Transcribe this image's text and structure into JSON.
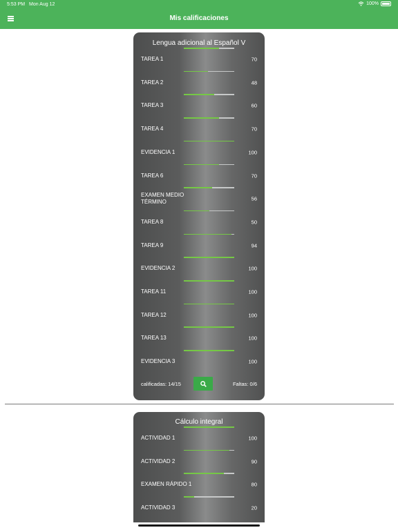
{
  "status": {
    "time": "5:53 PM",
    "date": "Mon Aug 12",
    "battery": "100%"
  },
  "header": {
    "title": "Mis calificaciones"
  },
  "courses": [
    {
      "title": "Lengua adicional al Español V",
      "items": [
        {
          "label": "TAREA 1",
          "score": "70",
          "value": 0.7
        },
        {
          "label": "TAREA 2",
          "score": "48",
          "value": 0.48
        },
        {
          "label": "TAREA 3",
          "score": "60",
          "value": 0.6
        },
        {
          "label": "TAREA 4",
          "score": "70",
          "value": 0.7
        },
        {
          "label": "EVIDENCIA 1",
          "score": "100",
          "value": 1.0
        },
        {
          "label": "TAREA 6",
          "score": "70",
          "value": 0.7
        },
        {
          "label": "EXAMEN MEDIO TÉRMINO",
          "score": "56",
          "value": 0.56
        },
        {
          "label": "TAREA 8",
          "score": "50",
          "value": 0.5
        },
        {
          "label": "TAREA 9",
          "score": "94",
          "value": 0.94
        },
        {
          "label": "EVIDENCIA 2",
          "score": "100",
          "value": 1.0
        },
        {
          "label": "TAREA 11",
          "score": "100",
          "value": 1.0
        },
        {
          "label": "TAREA 12",
          "score": "100",
          "value": 1.0
        },
        {
          "label": "TAREA 13",
          "score": "100",
          "value": 1.0
        },
        {
          "label": "EVIDENCIA 3",
          "score": "100",
          "value": 1.0
        }
      ],
      "graded": "calificadas: 14/15",
      "absences": "Faltas: 0/6"
    },
    {
      "title": "Cálculo integral",
      "items": [
        {
          "label": "ACTIVIDAD 1",
          "score": "100",
          "value": 1.0
        },
        {
          "label": "ACTIVIDAD 2",
          "score": "90",
          "value": 0.9
        },
        {
          "label": "EXAMEN RÁPIDO 1",
          "score": "80",
          "value": 0.8
        },
        {
          "label": "ACTIVIDAD 3",
          "score": "20",
          "value": 0.2
        }
      ]
    }
  ],
  "icons": {
    "menu": "hamburger-menu-icon",
    "search": "search-icon",
    "wifi": "wifi-icon",
    "battery": "battery-icon"
  },
  "colors": {
    "header": "#4cb35a",
    "progress": "#75c845",
    "button": "#3aaa48"
  }
}
